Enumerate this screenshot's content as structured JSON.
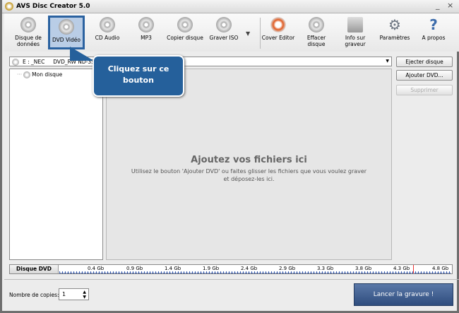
{
  "window": {
    "title": "AVS Disc Creator 5.0",
    "minimize": "_",
    "close": "×"
  },
  "toolbar": [
    {
      "label": "Disque de données",
      "icon": "data-disc-icon"
    },
    {
      "label": "DVD Vidéo",
      "icon": "dvd-video-icon"
    },
    {
      "label": "CD Audio",
      "icon": "cd-audio-icon"
    },
    {
      "label": "MP3",
      "icon": "mp3-icon"
    },
    {
      "label": "Copier disque",
      "icon": "copy-disc-icon"
    },
    {
      "label": "Graver ISO",
      "icon": "burn-iso-icon"
    },
    {
      "label": "Cover Editor",
      "icon": "cover-editor-icon"
    },
    {
      "label": "Effacer disque",
      "icon": "erase-disc-icon"
    },
    {
      "label": "Info sur graveur",
      "icon": "burner-info-icon"
    },
    {
      "label": "Paramètres",
      "icon": "gear-icon"
    },
    {
      "label": "A propos",
      "icon": "help-icon"
    }
  ],
  "drive": "E : _NEC     DVD_RW ND-3540A",
  "buttons": {
    "eject": "Ejecter disque",
    "add": "Ajouter DVD...",
    "remove": "Supprimer",
    "burn": "Lancer la gravure !"
  },
  "tree": {
    "root": "Mon disque"
  },
  "drop": {
    "heading": "Ajoutez vos fichiers ici",
    "text": "Utilisez le bouton 'Ajouter DVD' ou faites glisser les fichiers que vous voulez graver et déposez-les ici."
  },
  "disk_bar": {
    "label": "Disque DVD",
    "ticks": [
      "0.4 Gb",
      "0.9 Gb",
      "1.4 Gb",
      "1.9 Gb",
      "2.4 Gb",
      "2.9 Gb",
      "3.3 Gb",
      "3.8 Gb",
      "4.3 Gb",
      "4.8 Gb"
    ]
  },
  "copies": {
    "label": "Nombre de copies:",
    "value": "1"
  },
  "callout": "Cliquez sur ce bouton"
}
